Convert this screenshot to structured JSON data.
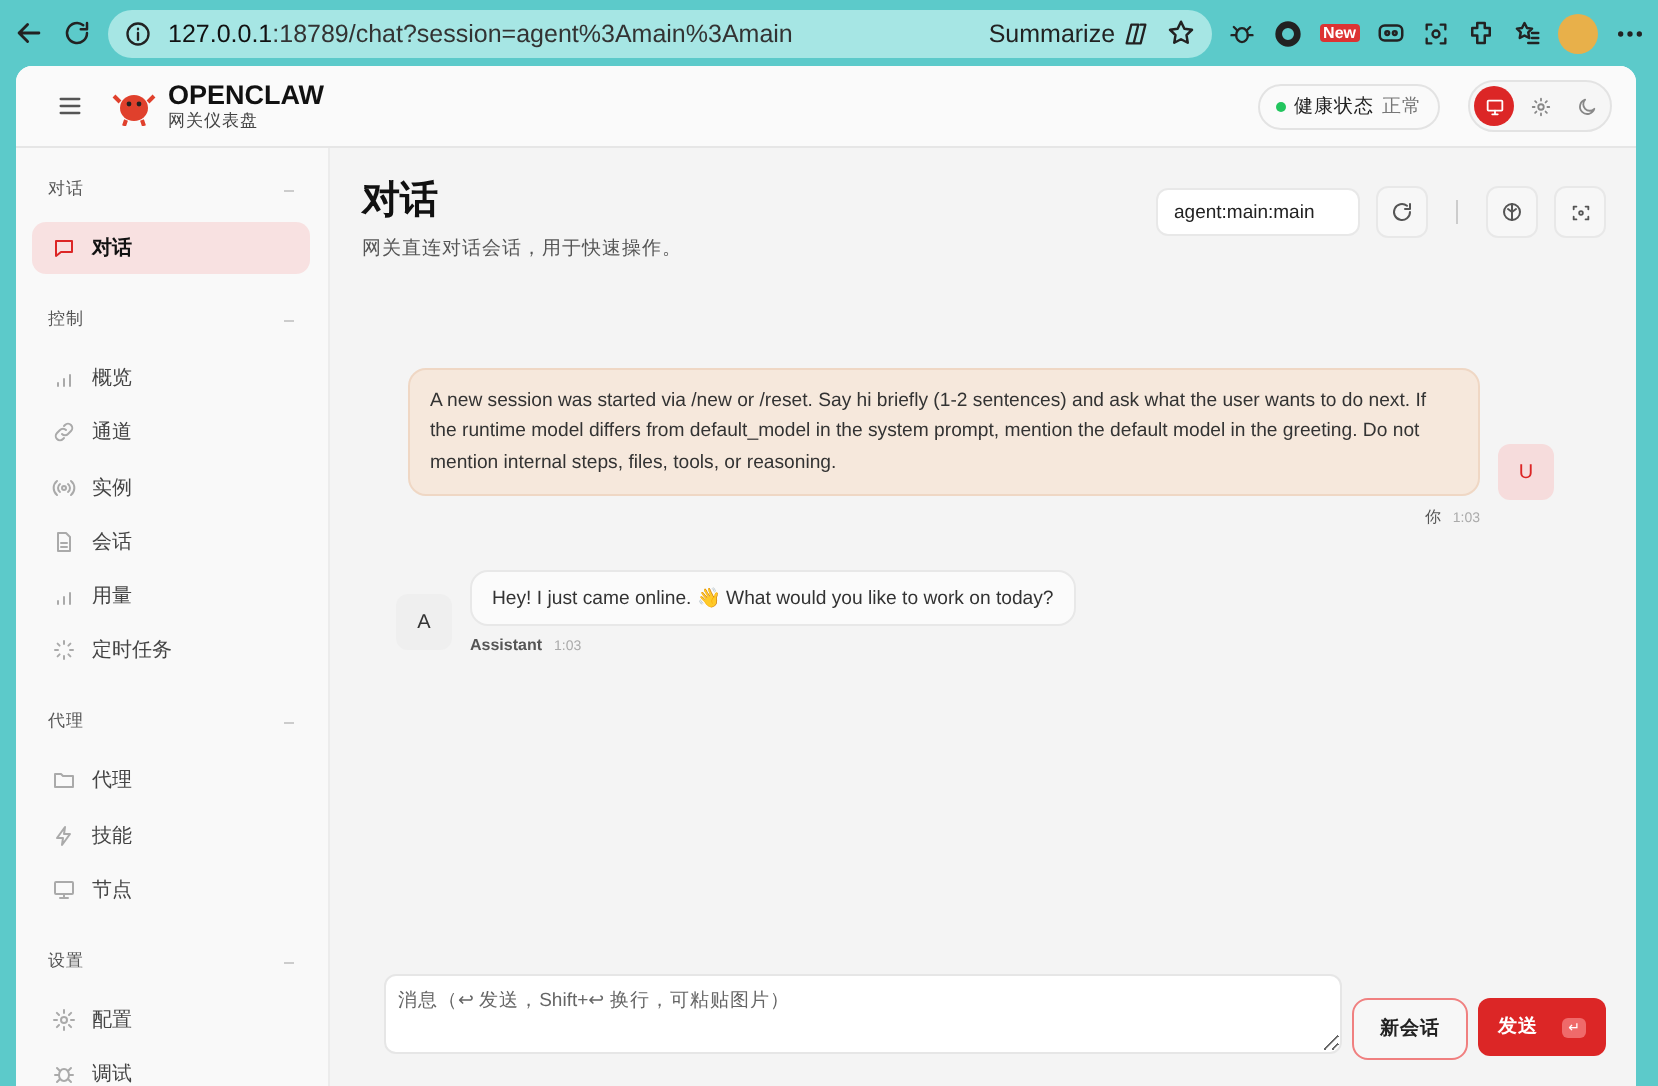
{
  "browser": {
    "url_host": "127.0.0.1",
    "url_rest": ":18789/chat?session=agent%3Amain%3Amain",
    "summarize": "Summarize",
    "new_badge": "New"
  },
  "app": {
    "brand": "OPENCLAW",
    "subtitle": "网关仪表盘",
    "health": {
      "label": "健康状态",
      "value": "正常",
      "ok": true
    },
    "theme_modes": [
      {
        "kind": "system",
        "selected": true
      },
      {
        "kind": "light",
        "selected": false
      },
      {
        "kind": "dark",
        "selected": false
      }
    ]
  },
  "sidebar": {
    "groups": [
      {
        "title": "对话",
        "items": [
          {
            "label": "对话",
            "kind": "chat",
            "selected": true
          }
        ]
      },
      {
        "title": "控制",
        "items": [
          {
            "label": "概览",
            "kind": "bars",
            "selected": false
          },
          {
            "label": "通道",
            "kind": "link",
            "selected": false
          },
          {
            "label": "实例",
            "kind": "radio",
            "selected": false
          },
          {
            "label": "会话",
            "kind": "file",
            "selected": false
          },
          {
            "label": "用量",
            "kind": "bars",
            "selected": false
          },
          {
            "label": "定时任务",
            "kind": "loader",
            "selected": false
          }
        ]
      },
      {
        "title": "代理",
        "items": [
          {
            "label": "代理",
            "kind": "folder",
            "selected": false
          },
          {
            "label": "技能",
            "kind": "zap",
            "selected": false
          },
          {
            "label": "节点",
            "kind": "monitor",
            "selected": false
          }
        ]
      },
      {
        "title": "设置",
        "items": [
          {
            "label": "配置",
            "kind": "gear",
            "selected": false
          },
          {
            "label": "调试",
            "kind": "bug",
            "selected": false
          }
        ]
      }
    ]
  },
  "page": {
    "title": "对话",
    "subtitle": "网关直连对话会话，用于快速操作。",
    "session": "agent:main:main"
  },
  "messages": [
    {
      "kind": "user",
      "text": "A new session was started via /new or /reset. Say hi briefly (1-2 sentences) and ask what the user wants to do next. If the runtime model differs from default_model in the system prompt, mention the default model in the greeting. Do not mention internal steps, files, tools, or reasoning.",
      "sender": "你",
      "time": "1:03",
      "avatar": "U"
    },
    {
      "kind": "assistant",
      "text": "Hey! I just came online. 👋 What would you like to work on today?",
      "sender": "Assistant",
      "time": "1:03",
      "avatar": "A"
    }
  ],
  "composer": {
    "placeholder": "消息（↩ 发送，Shift+↩ 换行，可粘贴图片）",
    "new_session": "新会话",
    "send": "发送",
    "send_key": "↵"
  }
}
